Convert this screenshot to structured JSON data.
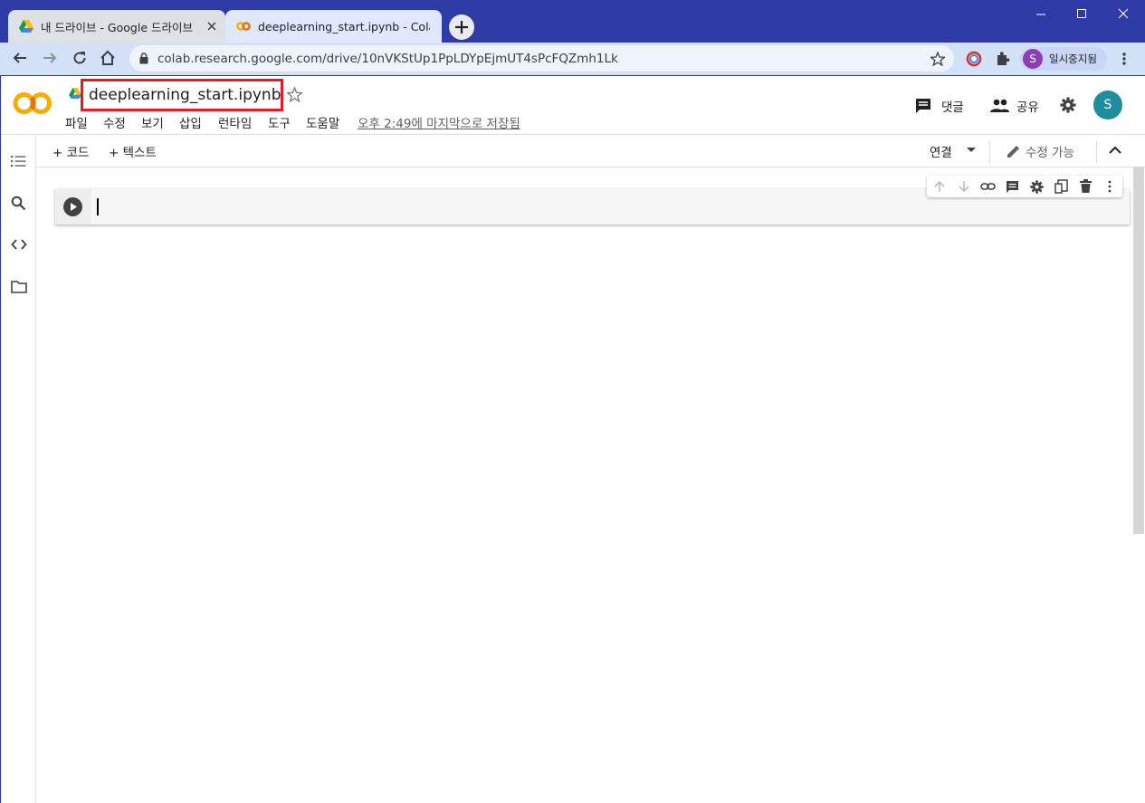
{
  "browser": {
    "tabs": [
      {
        "title": "내 드라이브 - Google 드라이브",
        "active": false
      },
      {
        "title": "deeplearning_start.ipynb - Colab",
        "active": true
      }
    ],
    "url": "colab.research.google.com/drive/10nVKStUp1PpLDYpEjmUT4sPcFQZmh1Lk",
    "profile_label": "일시중지됨",
    "profile_initial": "S"
  },
  "colab": {
    "logo": "CO",
    "notebook_title": "deeplearning_start.ipynb",
    "menu": [
      "파일",
      "수정",
      "보기",
      "삽입",
      "런타임",
      "도구",
      "도움말"
    ],
    "last_saved": "오후 2:49에 마지막으로 저장됨",
    "comment_label": "댓글",
    "share_label": "공유",
    "avatar_initial": "S",
    "toolbar": {
      "add_code": "+ 코드",
      "add_text": "+ 텍스트",
      "connect": "연결",
      "edit_mode": "수정 가능"
    },
    "cell_text": ""
  },
  "colors": {
    "titlebar": "#2e3aa6",
    "address_bar": "#d3e1f8",
    "highlight_box": "#e31b23",
    "avatar": "#1e8e9e",
    "colab_orange": "#f9ab00"
  }
}
